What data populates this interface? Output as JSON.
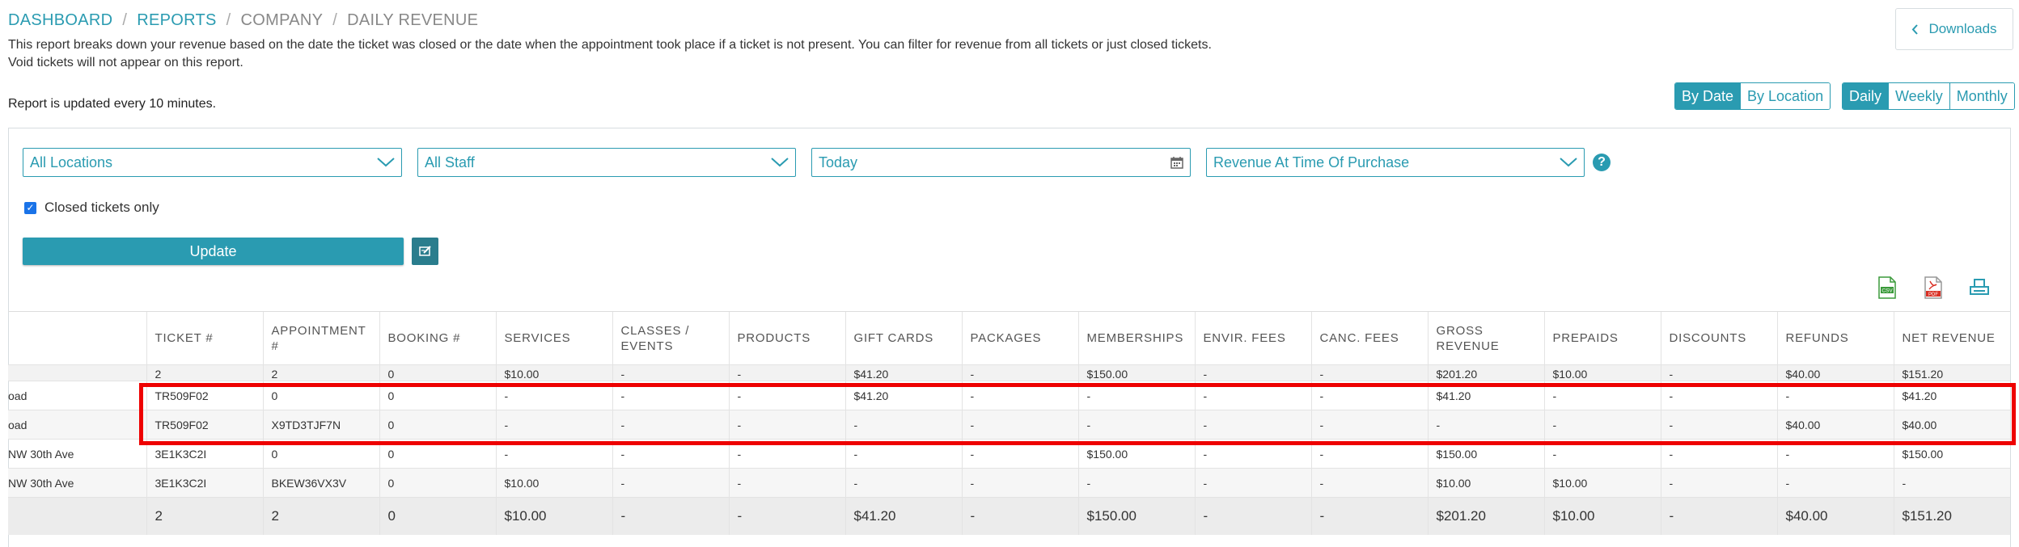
{
  "breadcrumb": [
    "DASHBOARD",
    "REPORTS",
    "COMPANY",
    "DAILY REVENUE"
  ],
  "breadcrumb_sep": "/",
  "description": [
    "This report breaks down your revenue based on the date the ticket was closed or the date when the appointment took place if a ticket is not present. You can filter for revenue from all tickets or just closed tickets.",
    "Void tickets will not appear on this report."
  ],
  "updated_note": "Report is updated every 10 minutes.",
  "downloads_label": "Downloads",
  "view_toggle": {
    "by_date": "By Date",
    "by_location": "By Location",
    "active": "By Date"
  },
  "period_toggle": {
    "daily": "Daily",
    "weekly": "Weekly",
    "monthly": "Monthly",
    "active": "Daily"
  },
  "filters": {
    "location": "All Locations",
    "staff": "All Staff",
    "date": "Today",
    "revenue_type": "Revenue At Time Of Purchase"
  },
  "closed_only": {
    "label": "Closed tickets only",
    "checked": true
  },
  "update_label": "Update",
  "help_glyph": "?",
  "columns": [
    "",
    "TICKET #",
    "APPOINTMENT #",
    "BOOKING #",
    "SERVICES",
    "CLASSES / EVENTS",
    "PRODUCTS",
    "GIFT CARDS",
    "PACKAGES",
    "MEMBERSHIPS",
    "ENVIR. FEES",
    "CANC. FEES",
    "GROSS REVENUE",
    "PREPAIDS",
    "DISCOUNTS",
    "REFUNDS",
    "NET REVENUE"
  ],
  "summary_row": [
    "",
    "2",
    "2",
    "0",
    "$10.00",
    "-",
    "-",
    "$41.20",
    "-",
    "$150.00",
    "-",
    "-",
    "$201.20",
    "$10.00",
    "-",
    "$40.00",
    "$151.20"
  ],
  "rows": [
    [
      "oad",
      "TR509F02",
      "0",
      "0",
      "-",
      "-",
      "-",
      "$41.20",
      "-",
      "-",
      "-",
      "-",
      "$41.20",
      "-",
      "-",
      "-",
      "$41.20"
    ],
    [
      "oad",
      "TR509F02",
      "X9TD3TJF7N",
      "0",
      "-",
      "-",
      "-",
      "-",
      "-",
      "-",
      "-",
      "-",
      "-",
      "-",
      "-",
      "$40.00",
      "$40.00"
    ],
    [
      "NW 30th Ave",
      "3E1K3C2I",
      "0",
      "0",
      "-",
      "-",
      "-",
      "-",
      "-",
      "$150.00",
      "-",
      "-",
      "$150.00",
      "-",
      "-",
      "-",
      "$150.00"
    ],
    [
      "NW 30th Ave",
      "3E1K3C2I",
      "BKEW36VX3V",
      "0",
      "$10.00",
      "-",
      "-",
      "-",
      "-",
      "-",
      "-",
      "-",
      "$10.00",
      "$10.00",
      "-",
      "-",
      "-"
    ]
  ],
  "total_row": [
    "",
    "2",
    "2",
    "0",
    "$10.00",
    "-",
    "-",
    "$41.20",
    "-",
    "$150.00",
    "-",
    "-",
    "$201.20",
    "$10.00",
    "-",
    "$40.00",
    "$151.20"
  ],
  "colors": {
    "accent": "#2a9bb1",
    "negative": "#e0401c",
    "highlight": "#ee0000"
  },
  "icons": {
    "downloads": "chevron-left-icon",
    "date": "calendar-icon",
    "csv": "csv-file-icon",
    "pdf": "pdf-file-icon",
    "print": "print-icon",
    "edit": "edit-report-icon"
  }
}
